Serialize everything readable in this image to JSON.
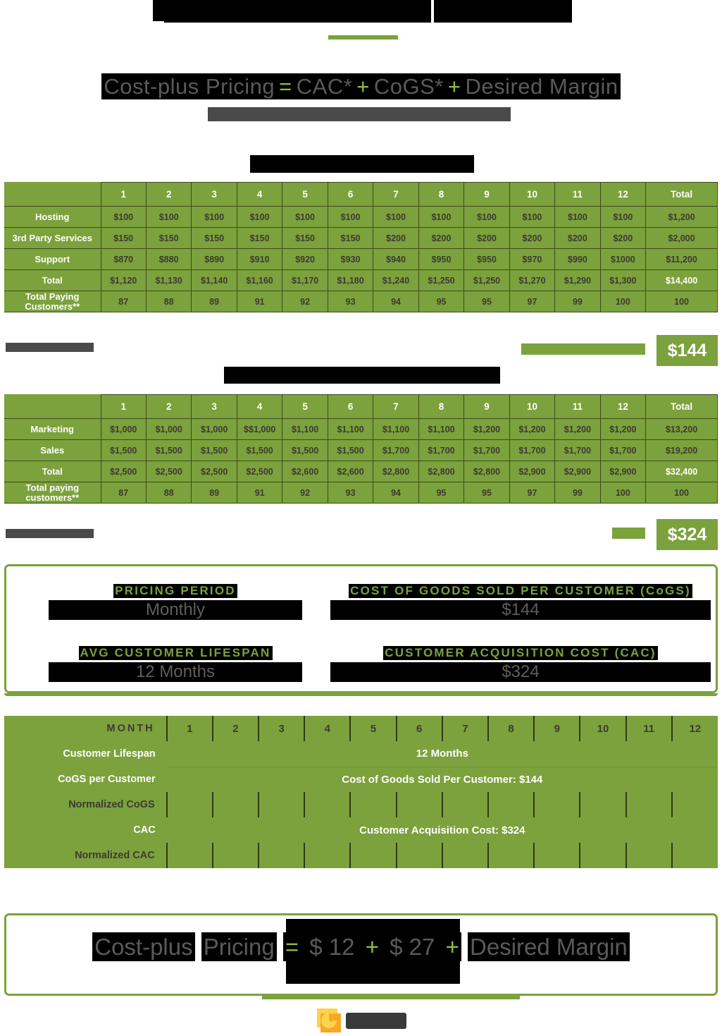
{
  "header": {
    "title_redacted": true,
    "accent_color": "#7ba23c"
  },
  "formula_top": {
    "parts": [
      {
        "text": "Cost-plus Pricing",
        "type": "term"
      },
      {
        "text": "=",
        "type": "op"
      },
      {
        "text": "CAC*",
        "type": "term"
      },
      {
        "text": "+",
        "type": "op"
      },
      {
        "text": "CoGS*",
        "type": "term"
      },
      {
        "text": "+",
        "type": "op"
      },
      {
        "text": "Desired Margin",
        "type": "term"
      }
    ]
  },
  "cogs_table": {
    "caption_redacted": true,
    "columns": [
      "",
      "1",
      "2",
      "3",
      "4",
      "5",
      "6",
      "7",
      "8",
      "9",
      "10",
      "11",
      "12",
      "Total"
    ],
    "rows": [
      {
        "label": "Hosting",
        "values": [
          "$100",
          "$100",
          "$100",
          "$100",
          "$100",
          "$100",
          "$100",
          "$100",
          "$100",
          "$100",
          "$100",
          "$100"
        ],
        "total": "$1,200"
      },
      {
        "label": "3rd Party Services",
        "values": [
          "$150",
          "$150",
          "$150",
          "$150",
          "$150",
          "$150",
          "$200",
          "$200",
          "$200",
          "$200",
          "$200",
          "$200"
        ],
        "total": "$2,000"
      },
      {
        "label": "Support",
        "values": [
          "$870",
          "$880",
          "$890",
          "$910",
          "$920",
          "$930",
          "$940",
          "$950",
          "$950",
          "$970",
          "$990",
          "$1000"
        ],
        "total": "$11,200"
      },
      {
        "label": "Total",
        "values": [
          "$1,120",
          "$1,130",
          "$1,140",
          "$1,160",
          "$1,170",
          "$1,180",
          "$1,240",
          "$1,250",
          "$1,250",
          "$1,270",
          "$1,290",
          "$1,300"
        ],
        "total": "$14,400",
        "emphasis": true
      },
      {
        "label": "Total Paying Customers**",
        "values": [
          "87",
          "88",
          "89",
          "91",
          "92",
          "93",
          "94",
          "95",
          "95",
          "97",
          "99",
          "100"
        ],
        "total": "100",
        "plain": true
      }
    ],
    "result": "$144"
  },
  "cac_table": {
    "caption_redacted": true,
    "columns": [
      "",
      "1",
      "2",
      "3",
      "4",
      "5",
      "6",
      "7",
      "8",
      "9",
      "10",
      "11",
      "12",
      "Total"
    ],
    "rows": [
      {
        "label": "Marketing",
        "values": [
          "$1,000",
          "$1,000",
          "$1,000",
          "$$1,000",
          "$1,100",
          "$1,100",
          "$1,100",
          "$1,100",
          "$1,200",
          "$1,200",
          "$1,200",
          "$1,200"
        ],
        "total": "$13,200"
      },
      {
        "label": "Sales",
        "values": [
          "$1,500",
          "$1,500",
          "$1,500",
          "$1,500",
          "$1,500",
          "$1,500",
          "$1,700",
          "$1,700",
          "$1,700",
          "$1,700",
          "$1,700",
          "$1,700"
        ],
        "total": "$19,200"
      },
      {
        "label": "Total",
        "values": [
          "$2,500",
          "$2,500",
          "$2,500",
          "$2,500",
          "$2,600",
          "$2,600",
          "$2,800",
          "$2,800",
          "$2,800",
          "$2,900",
          "$2,900",
          "$2,900"
        ],
        "total": "$32,400",
        "emphasis": true
      },
      {
        "label": "Total paying customers**",
        "values": [
          "87",
          "88",
          "89",
          "91",
          "92",
          "93",
          "94",
          "95",
          "95",
          "97",
          "99",
          "100"
        ],
        "total": "100",
        "plain": true
      }
    ],
    "result": "$324"
  },
  "info_card": {
    "items": [
      {
        "label": "PRICING PERIOD",
        "value": "Monthly"
      },
      {
        "label": "COST OF GOODS SOLD PER CUSTOMER (CoGS)",
        "value": "$144"
      },
      {
        "label": "AVG CUSTOMER LIFESPAN",
        "value": "12 Months"
      },
      {
        "label": "CUSTOMER ACQUISITION COST (CAC)",
        "value": "$324"
      }
    ]
  },
  "month_table": {
    "month_header": "MONTH",
    "months": [
      "1",
      "2",
      "3",
      "4",
      "5",
      "6",
      "7",
      "8",
      "9",
      "10",
      "11",
      "12"
    ],
    "rows": [
      {
        "label": "Customer Lifespan",
        "span_text": "12 Months",
        "style": "span-plain"
      },
      {
        "label": "CoGS per Customer",
        "span_text": "Cost of Goods Sold Per Customer: $144",
        "style": "span-rule"
      },
      {
        "label": "Normalized CoGS",
        "span_text": "",
        "style": "ticks"
      },
      {
        "label": "CAC",
        "span_text": "Customer Acquisition Cost: $324",
        "style": "span-plain"
      },
      {
        "label": "Normalized CAC",
        "span_text": "",
        "style": "ticks"
      }
    ]
  },
  "formula_bottom": {
    "parts": [
      {
        "text": "Cost-plus",
        "type": "term"
      },
      {
        "text": "Pricing",
        "type": "term"
      },
      {
        "text": "=",
        "type": "op"
      },
      {
        "text": "$ 12",
        "type": "term"
      },
      {
        "text": "+",
        "type": "op"
      },
      {
        "text": "$ 27",
        "type": "term"
      },
      {
        "text": "+",
        "type": "op"
      },
      {
        "text": "Desired Margin",
        "type": "term"
      }
    ]
  },
  "logo": {
    "mark_name": "pie-chart-logo-icon",
    "wordmark_redacted": true,
    "mark_colors": [
      "#fbd34d",
      "#f9a825"
    ]
  }
}
